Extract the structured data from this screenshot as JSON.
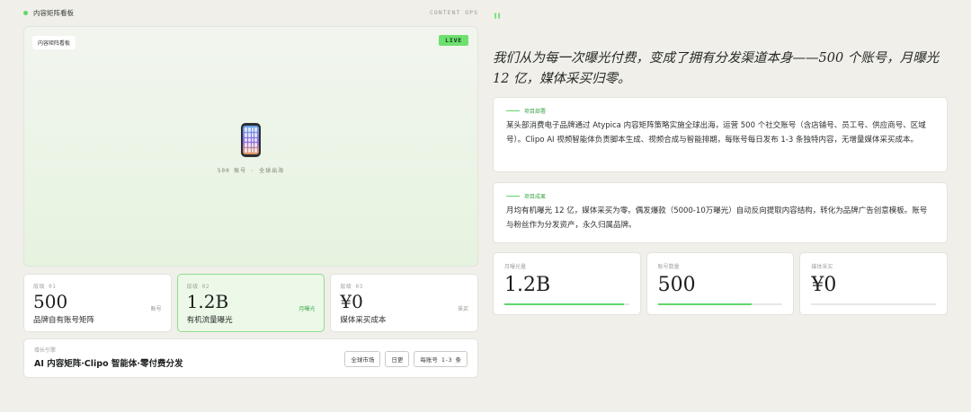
{
  "topbar": {
    "brand": "内容矩阵看板",
    "section": "CONTENT OPS"
  },
  "hero": {
    "tag": "内容矩阵看板",
    "live": "LIVE",
    "caption": "500 账号 · 全球出海"
  },
  "layers": [
    {
      "level": "层级 01",
      "value": "500",
      "unit": "账号",
      "desc": "品牌自有账号矩阵",
      "active": false
    },
    {
      "level": "层级 02",
      "value": "1.2B",
      "unit": "月曝光",
      "desc": "有机流量曝光",
      "active": true
    },
    {
      "level": "层级 03",
      "value": "¥0",
      "unit": "采买",
      "desc": "媒体采买成本",
      "active": false
    }
  ],
  "engine": {
    "label": "增长引擎",
    "title": "AI 内容矩阵·Clipo 智能体·零付费分发",
    "chips": [
      "全球市场",
      "日更",
      "每账号 1-3 条"
    ]
  },
  "quote": {
    "mark": "\"",
    "text": "我们从为每一次曝光付费，变成了拥有分发渠道本身——500 个账号，月曝光 12 亿，媒体采买归零。"
  },
  "deployment": {
    "tag": "项目部署",
    "body": "某头部消费电子品牌通过 Atypica 内容矩阵策略实施全球出海，运营 500 个社交账号（含店铺号、员工号、供应商号、区域号）。Clipo AI 视频智能体负责脚本生成、视频合成与智能排期，每账号每日发布 1-3 条独特内容，无增量媒体采买成本。"
  },
  "results": {
    "tag": "项目成果",
    "body": "月均有机曝光 12 亿，媒体采买为零。偶发爆款（5000-10万曝光）自动反向提取内容结构，转化为品牌广告创意模板。账号与粉丝作为分发资产，永久归属品牌。"
  },
  "metrics": [
    {
      "label": "月曝光量",
      "value": "1.2B",
      "progress": 0.96
    },
    {
      "label": "账号数量",
      "value": "500",
      "progress": 0.75
    },
    {
      "label": "媒体采买",
      "value": "¥0",
      "progress": 0
    }
  ],
  "colors": {
    "accent": "#5fd76a",
    "background": "#f1efe9"
  }
}
